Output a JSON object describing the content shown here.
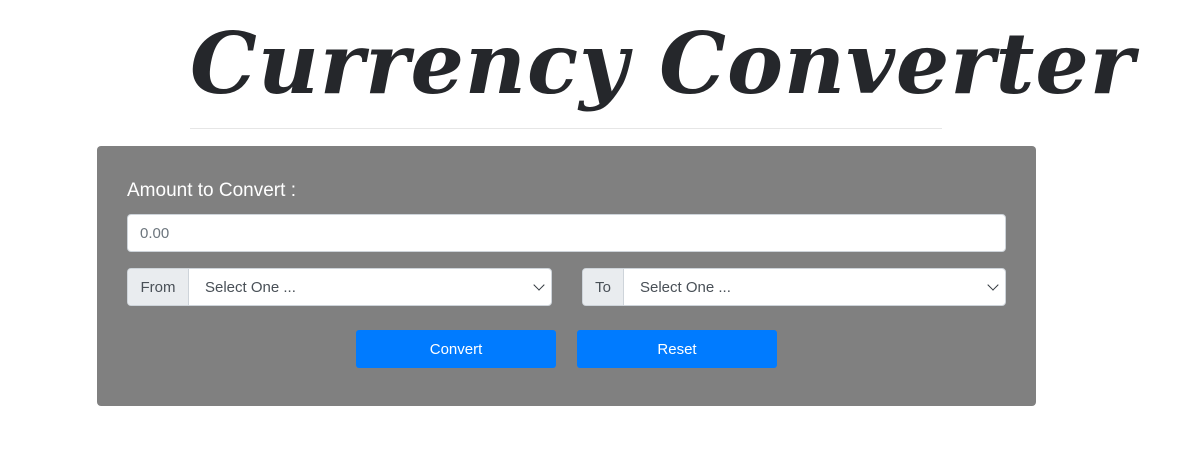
{
  "header": {
    "title": "Currency Converter"
  },
  "form": {
    "amount_label": "Amount to Convert :",
    "amount_placeholder": "0.00",
    "from": {
      "label": "From",
      "selected": "Select One ..."
    },
    "to": {
      "label": "To",
      "selected": "Select One ..."
    },
    "convert_label": "Convert",
    "reset_label": "Reset"
  },
  "colors": {
    "panel": "#808080",
    "button": "#007bff",
    "title": "#25272b"
  }
}
